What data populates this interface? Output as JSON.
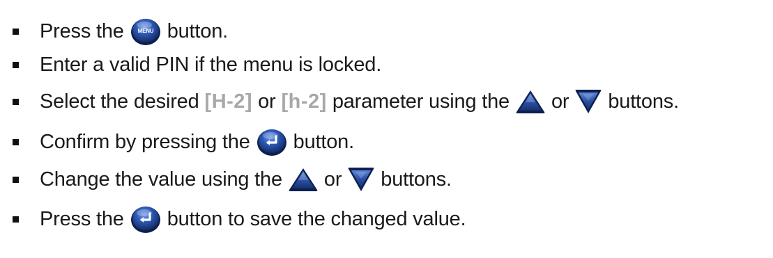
{
  "steps": [
    {
      "before": "Press the",
      "icon": "menu-button-icon",
      "icon_label": "MENU",
      "after": "button."
    },
    {
      "text": "Enter a valid PIN if the menu is locked."
    },
    {
      "before": "Select the desired",
      "code1": "[H-2]",
      "or": "or",
      "code2": "[h-2]",
      "mid": "parameter using the",
      "icon1": "up-triangle-icon",
      "or2": "or",
      "icon2": "down-triangle-icon",
      "after": "buttons."
    },
    {
      "before": "Confirm by pressing the",
      "icon": "enter-button-icon",
      "after": "button."
    },
    {
      "before": "Change the value using the",
      "icon1": "up-triangle-icon",
      "or": "or",
      "icon2": "down-triangle-icon",
      "after": "buttons."
    },
    {
      "before": "Press the",
      "icon": "enter-button-icon",
      "after": "button to save the changed value."
    }
  ],
  "colors": {
    "text": "#1a1a1a",
    "code": "#a8a8a8",
    "icon_blue": "#1f3f8f",
    "icon_blue_light": "#4a74c9"
  }
}
